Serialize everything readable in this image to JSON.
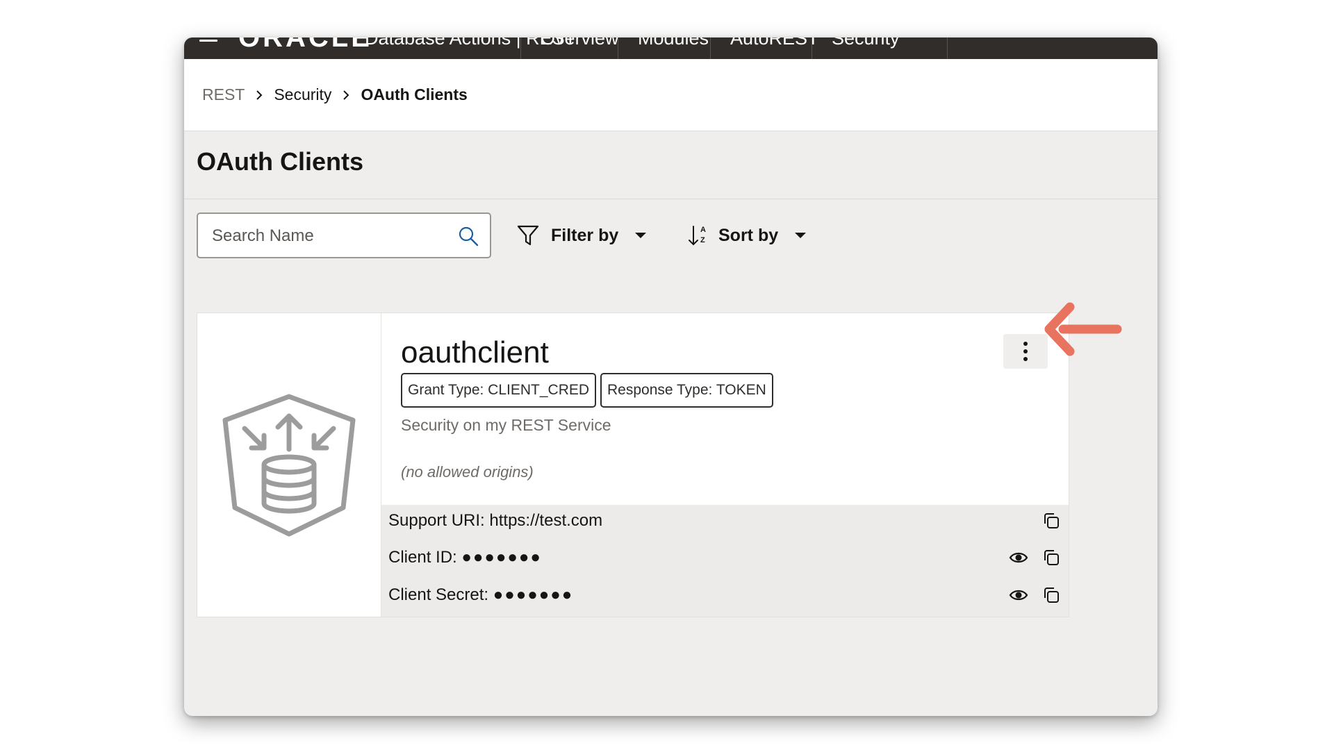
{
  "topbar": {
    "logo": "ORACLE",
    "product": "Database Actions | REST",
    "tabs": [
      "Overview",
      "Modules",
      "AutoREST",
      "Security"
    ]
  },
  "breadcrumb": {
    "items": [
      "REST",
      "Security",
      "OAuth Clients"
    ]
  },
  "page": {
    "title": "OAuth Clients"
  },
  "toolbar": {
    "search_placeholder": "Search Name",
    "filter_label": "Filter by",
    "sort_label": "Sort by"
  },
  "client": {
    "name": "oauthclient",
    "grant_type": "Grant Type: CLIENT_CRED",
    "response_type": "Response Type: TOKEN",
    "description": "Security on my REST Service",
    "origins": "(no allowed origins)",
    "support_uri_label": "Support URI: https://test.com",
    "client_id_label": "Client ID:",
    "client_id_mask": "●●●●●●●",
    "client_secret_label": "Client Secret:",
    "client_secret_mask": "●●●●●●●"
  },
  "colors": {
    "header_bg": "#312d2a",
    "arrow": "#e8735f",
    "page_bg": "#efeeec"
  },
  "icons": [
    "menu-icon",
    "search-icon",
    "filter-icon",
    "sort-icon",
    "caret-down-icon",
    "kebab-menu-icon",
    "copy-icon",
    "eye-icon",
    "database-shield-icon",
    "pointer-arrow-icon"
  ]
}
